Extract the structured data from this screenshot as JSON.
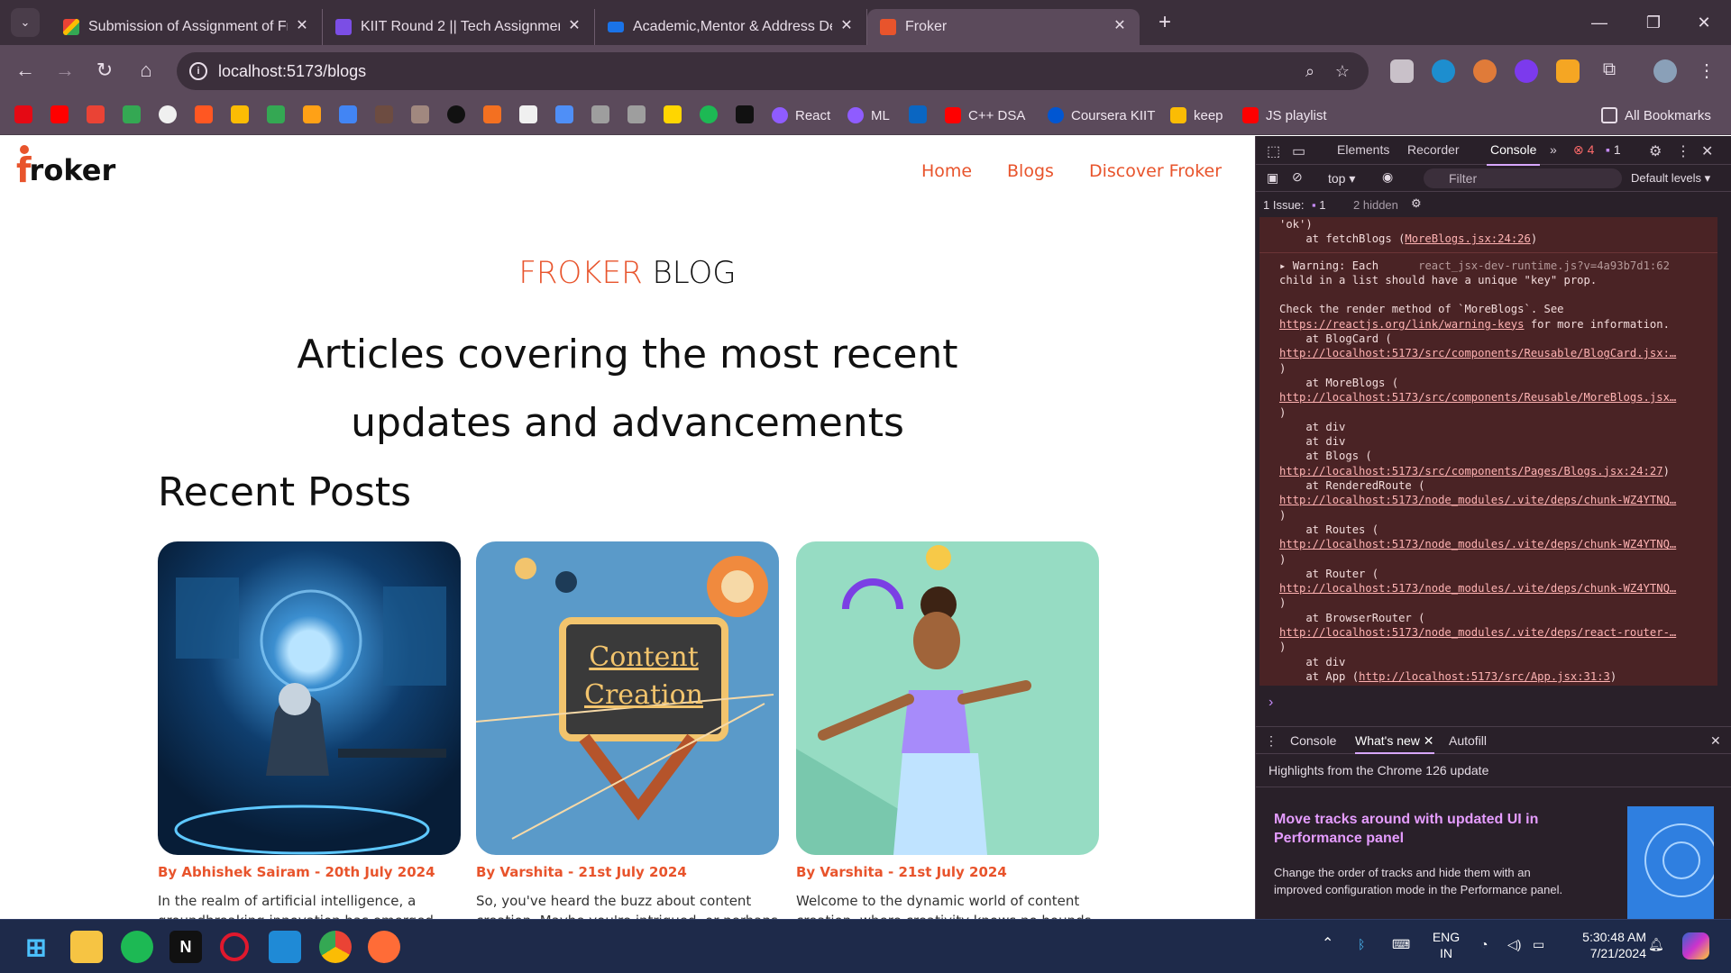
{
  "browser": {
    "tabs": [
      {
        "title": "Submission of Assignment of Fr",
        "favicon_color": "#ea4335"
      },
      {
        "title": "KIIT Round 2 || Tech Assignment",
        "favicon_color": "#7b4ee5"
      },
      {
        "title": "Academic,Mentor & Address De",
        "favicon_color": "#1a73e8"
      },
      {
        "title": "Froker",
        "favicon_color": "#e8542c",
        "active": true
      }
    ],
    "url": "localhost:5173/blogs",
    "bookmarks": [
      {
        "label": "React",
        "icon_color": "#8f5cff"
      },
      {
        "label": "ML",
        "icon_color": "#8f5cff"
      },
      {
        "label": "C++ DSA",
        "icon_color": "#ff0000"
      },
      {
        "label": "Coursera KIIT",
        "icon_color": "#0056d2"
      },
      {
        "label": "keep",
        "icon_color": "#fbbc04"
      },
      {
        "label": "JS playlist",
        "icon_color": "#ff0000"
      }
    ],
    "all_bookmarks": "All Bookmarks"
  },
  "site": {
    "logo_f": "f",
    "logo_rest": "roker",
    "nav": [
      "Home",
      "Blogs",
      "Discover Froker"
    ],
    "blog_title_accent": "FROKER",
    "blog_title_rest": "BLOG",
    "hero_line1": "Articles covering the most recent",
    "hero_line2": "updates and advancements",
    "recent_heading": "Recent Posts",
    "accent_color": "#e8542c",
    "posts": [
      {
        "author": "By  Abhishek Sairam  -  20th July 2024",
        "excerpt": "In the realm of artificial intelligence, a groundbreaking innovation has emerged,"
      },
      {
        "author": "By  Varshita  -  21st July 2024",
        "excerpt": "So, you've heard the buzz about content creation. Maybe you're intrigued, or perhaps"
      },
      {
        "author": "By  Varshita  -  21st July 2024",
        "excerpt": "Welcome to the dynamic world of content creation, where creativity knows no bounds and"
      }
    ],
    "post2_image_text1": "Content",
    "post2_image_text2": "Creation"
  },
  "devtools": {
    "tabs": [
      "Elements",
      "Recorder",
      "Console"
    ],
    "error_count": "4",
    "issue_count": "1",
    "context": "top",
    "filter_placeholder": "Filter",
    "levels": "Default levels",
    "issues_label": "1 Issue:",
    "issues_n": "1",
    "hidden": "2 hidden",
    "console_lines": [
      "'ok')",
      "    at fetchBlogs (MoreBlogs.jsx:24:26)"
    ],
    "warning_head": "Warning: Each",
    "warning_src": "react_jsx-dev-runtime.js?v=4a93b7d1:62",
    "drawer_tabs": [
      "Console",
      "What's new",
      "Autofill"
    ],
    "drawer_highlight": "Highlights from the Chrome 126 update",
    "drawer_title": "Move tracks around with updated UI in Performance panel",
    "drawer_body": "Change the order of tracks and hide them with an improved configuration mode in the Performance panel."
  },
  "taskbar": {
    "lang": "ENG",
    "region": "IN",
    "time": "5:30:48 AM",
    "date": "7/21/2024"
  }
}
